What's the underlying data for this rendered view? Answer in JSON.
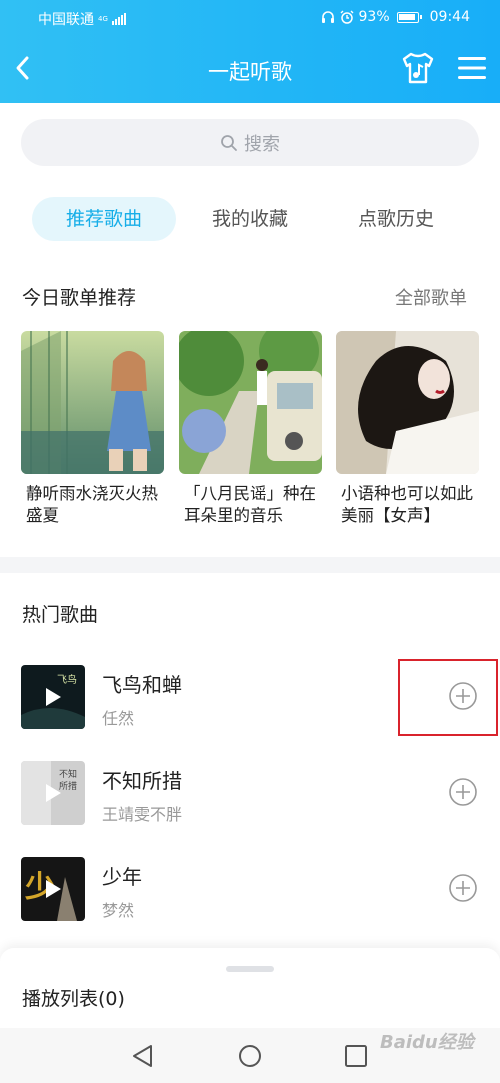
{
  "status_bar": {
    "carrier": "中国联通",
    "network": "4G",
    "battery": "93%",
    "time": "09:44"
  },
  "header": {
    "title": "一起听歌"
  },
  "search": {
    "placeholder": "搜索"
  },
  "tabs": [
    {
      "label": "推荐歌曲",
      "active": true
    },
    {
      "label": "我的收藏",
      "active": false
    },
    {
      "label": "点歌历史",
      "active": false
    }
  ],
  "recommend": {
    "title": "今日歌单推荐",
    "more_label": "全部歌单",
    "playlists": [
      {
        "title": "静听雨水浇灭火热盛夏"
      },
      {
        "title": "「八月民谣」种在耳朵里的音乐"
      },
      {
        "title": "小语种也可以如此美丽【女声】"
      }
    ]
  },
  "hot_songs": {
    "title": "热门歌曲",
    "songs": [
      {
        "name": "飞鸟和蝉",
        "artist": "任然"
      },
      {
        "name": "不知所措",
        "artist": "王靖雯不胖"
      },
      {
        "name": "少年",
        "artist": "梦然"
      }
    ]
  },
  "play_queue": {
    "label": "播放列表(0)"
  },
  "watermark": "Baidu经验",
  "colors": {
    "accent": "#17aee8",
    "header_gradient_start": "#31c0f4",
    "header_gradient_end": "#18aef8",
    "highlight": "#d9232c"
  }
}
